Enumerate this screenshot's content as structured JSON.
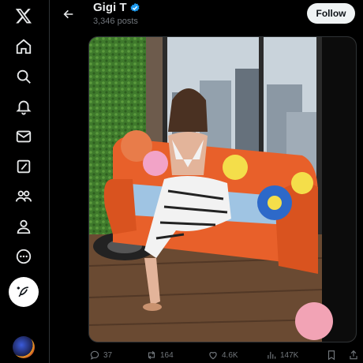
{
  "app": {
    "logo": "x-logo"
  },
  "nav": {
    "items": [
      {
        "icon": "home-icon"
      },
      {
        "icon": "search-icon"
      },
      {
        "icon": "bell-icon"
      },
      {
        "icon": "mail-icon"
      },
      {
        "icon": "grok-icon"
      },
      {
        "icon": "communities-icon"
      },
      {
        "icon": "profile-icon"
      },
      {
        "icon": "more-icon"
      }
    ],
    "compose_icon": "feather-plus-icon"
  },
  "header": {
    "name": "Gigi T",
    "posts": "3,346 posts",
    "follow_label": "Follow"
  },
  "media": {
    "description_icon": "photo-icon"
  },
  "actions": {
    "replies": "37",
    "reposts": "164",
    "likes": "4.6K",
    "views": "147K"
  },
  "colors": {
    "background": "#000000",
    "verified": "#1d9bf0",
    "muted": "#71767b",
    "sofa": "#e8602a"
  }
}
